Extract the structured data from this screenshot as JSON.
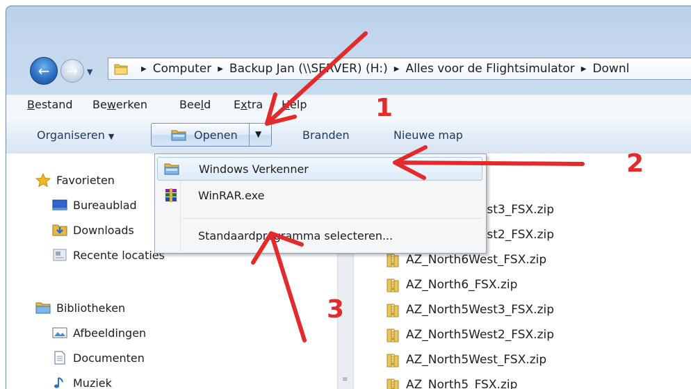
{
  "address_bar": {
    "crumbs": [
      "Computer",
      "Backup Jan (\\\\SERVER) (H:)",
      "Alles voor de Flightsimulator",
      "Downl"
    ]
  },
  "menu": {
    "items": [
      {
        "pre": "",
        "key": "B",
        "post": "estand"
      },
      {
        "pre": "Be",
        "key": "w",
        "post": "erken"
      },
      {
        "pre": "Bee",
        "key": "l",
        "post": "d"
      },
      {
        "pre": "E",
        "key": "x",
        "post": "tra"
      },
      {
        "pre": "",
        "key": "H",
        "post": "elp"
      }
    ]
  },
  "toolbar": {
    "organize": "Organiseren",
    "open": "Openen",
    "burn": "Branden",
    "new_folder": "Nieuwe map"
  },
  "open_menu": {
    "items": [
      "Windows Verkenner",
      "WinRAR.exe"
    ],
    "choose_default": "Standaardprogramma selecteren..."
  },
  "nav": {
    "favorites": "Favorieten",
    "favorites_items": [
      "Bureaublad",
      "Downloads",
      "Recente locaties"
    ],
    "libraries": "Bibliotheken",
    "libraries_items": [
      "Afbeeldingen",
      "Documenten",
      "Muziek"
    ]
  },
  "files": [
    "AZ_North6West3_FSX.zip",
    "AZ_North6West2_FSX.zip",
    "AZ_North6West_FSX.zip",
    "AZ_North6_FSX.zip",
    "AZ_North5West3_FSX.zip",
    "AZ_North5West2_FSX.zip",
    "AZ_North5West_FSX.zip",
    "AZ_North5_FSX.zip"
  ],
  "annotations": [
    "1",
    "2",
    "3"
  ],
  "colors": {
    "annotation": "#e42a2a",
    "selection": "#dcebfb",
    "toolbar_text": "#1e395b"
  }
}
